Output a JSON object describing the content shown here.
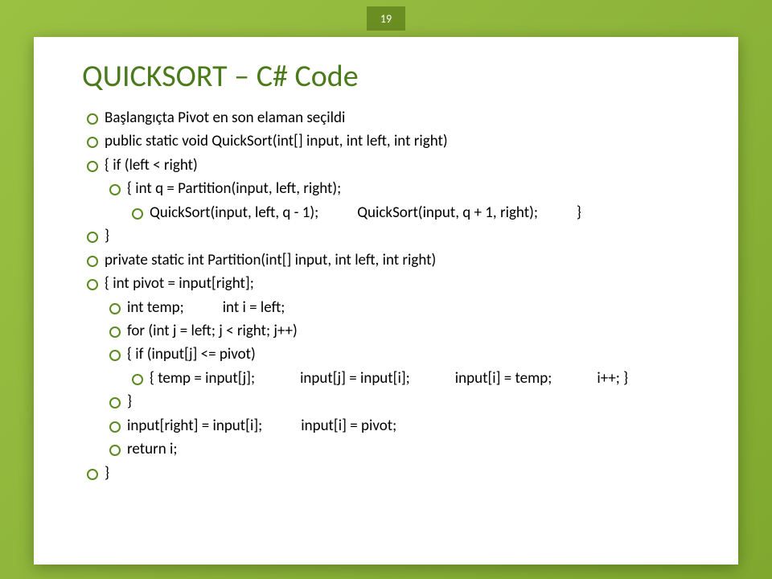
{
  "page_number": "19",
  "title": "QUICKSORT – C# Code",
  "lines": [
    {
      "indent": 0,
      "segments": [
        "Başlangıçta Pivot en son elaman seçildi"
      ]
    },
    {
      "indent": 0,
      "segments": [
        "public static void QuickSort(int[] input, int left, int right)"
      ]
    },
    {
      "indent": 0,
      "segments": [
        "{    if (left < right)"
      ]
    },
    {
      "indent": 1,
      "segments": [
        "{  int q = Partition(input, left, right);"
      ]
    },
    {
      "indent": 2,
      "segments": [
        "QuickSort(input, left, q - 1);",
        "QuickSort(input, q + 1, right);",
        "}"
      ],
      "gap": "sm"
    },
    {
      "indent": 0,
      "segments": [
        "}"
      ]
    },
    {
      "indent": 0,
      "segments": [
        "private static int Partition(int[] input, int left, int right)"
      ]
    },
    {
      "indent": 0,
      "segments": [
        "{   int pivot = input[right];"
      ]
    },
    {
      "indent": 1,
      "segments": [
        "int temp;",
        "int i = left;"
      ],
      "gap": "sm"
    },
    {
      "indent": 1,
      "segments": [
        "for (int j = left; j < right; j++)"
      ]
    },
    {
      "indent": 1,
      "segments": [
        "{  if (input[j] <= pivot)"
      ]
    },
    {
      "indent": 2,
      "segments": [
        "{   temp = input[j];",
        "input[j] = input[i];",
        "input[i] = temp;",
        "i++;  }"
      ],
      "gap": "md"
    },
    {
      "indent": 1,
      "segments": [
        "}"
      ]
    },
    {
      "indent": 1,
      "segments": [
        "input[right] = input[i];",
        "input[i] = pivot;"
      ],
      "gap": "sm"
    },
    {
      "indent": 1,
      "segments": [
        "return i;"
      ]
    },
    {
      "indent": 0,
      "segments": [
        "}"
      ]
    }
  ]
}
